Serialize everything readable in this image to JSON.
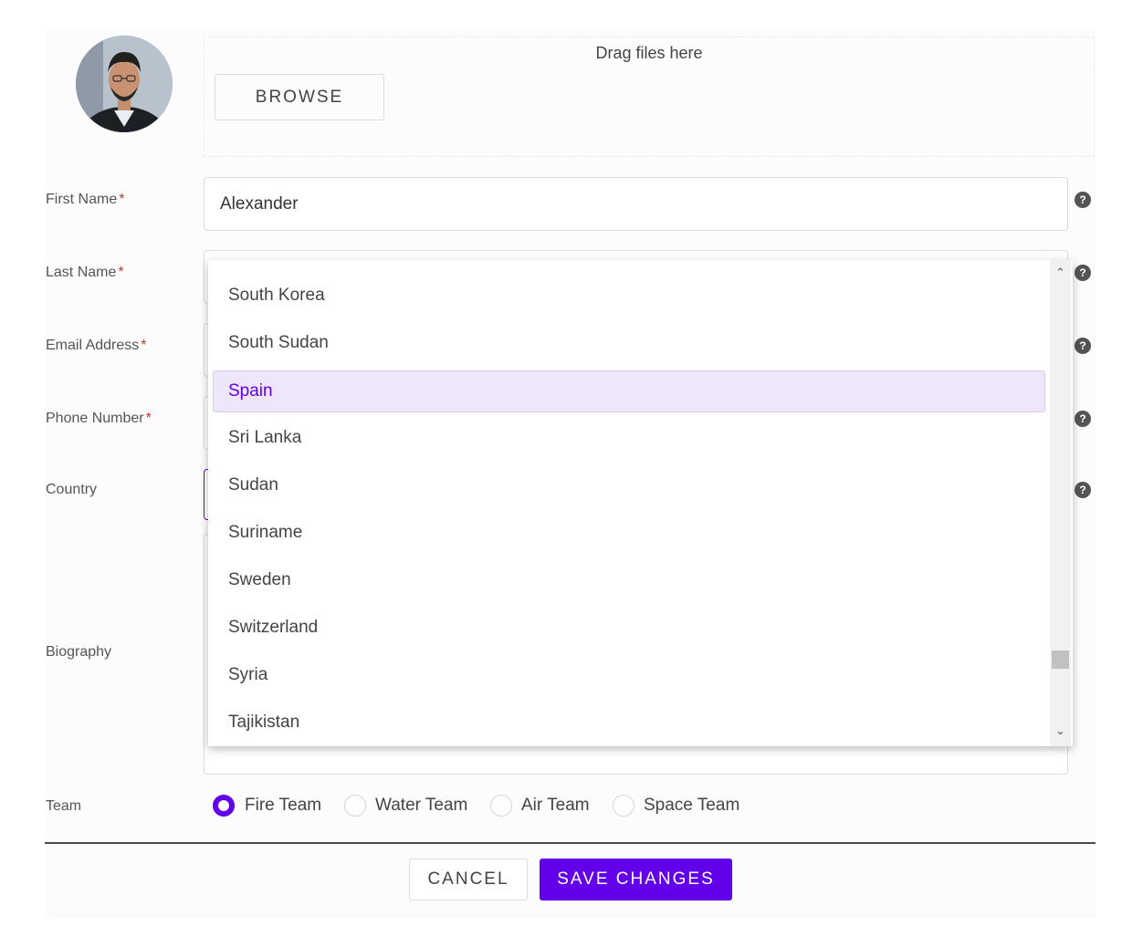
{
  "upload": {
    "drag_text": "Drag files here",
    "browse_label": "BROWSE"
  },
  "form": {
    "first_name_label": "First Name",
    "first_name_value": "Alexander",
    "last_name_label": "Last Name",
    "email_label": "Email Address",
    "phone_label": "Phone Number",
    "country_label": "Country",
    "biography_label": "Biography",
    "team_label": "Team",
    "required_mark": "*",
    "help_glyph": "?"
  },
  "country_dropdown": {
    "options": [
      "South Korea",
      "South Sudan",
      "Spain",
      "Sri Lanka",
      "Sudan",
      "Suriname",
      "Sweden",
      "Switzerland",
      "Syria",
      "Tajikistan"
    ],
    "selected": "Spain",
    "scroll_up_glyph": "⌃",
    "scroll_down_glyph": "⌄"
  },
  "team_options": [
    {
      "label": "Fire Team",
      "checked": true
    },
    {
      "label": "Water Team",
      "checked": false
    },
    {
      "label": "Air Team",
      "checked": false
    },
    {
      "label": "Space Team",
      "checked": false
    }
  ],
  "actions": {
    "cancel_label": "CANCEL",
    "save_label": "SAVE CHANGES"
  },
  "colors": {
    "accent": "#6200ea",
    "selected_option_bg": "#eee6fb",
    "required": "#c0392b"
  }
}
